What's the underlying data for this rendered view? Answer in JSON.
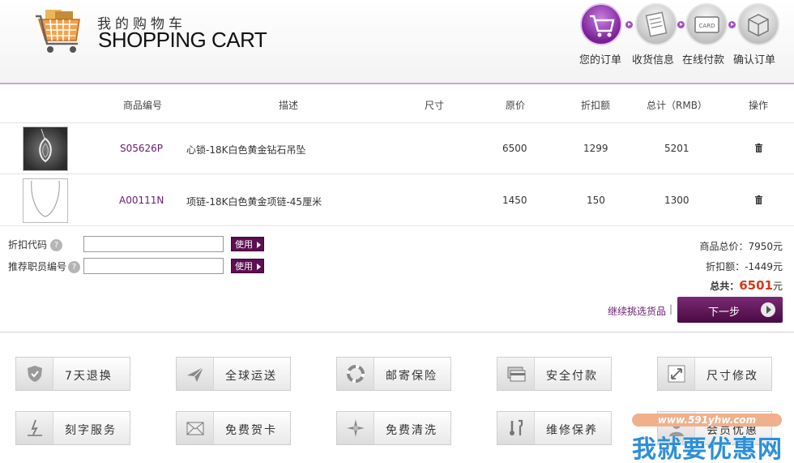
{
  "header": {
    "title_cn": "我的购物车",
    "title_en": "SHOPPING CART",
    "steps": [
      {
        "label": "您的订单",
        "active": true,
        "icon": "cart-icon"
      },
      {
        "label": "收货信息",
        "active": false,
        "icon": "document-icon"
      },
      {
        "label": "在线付款",
        "active": false,
        "icon": "card-icon",
        "icon_text": "CARD"
      },
      {
        "label": "确认订单",
        "active": false,
        "icon": "package-icon"
      }
    ]
  },
  "table": {
    "columns": [
      "商品编号",
      "描述",
      "尺寸",
      "原价",
      "折扣额",
      "总计（RMB）",
      "操作"
    ],
    "rows": [
      {
        "code": "S05626P",
        "desc": "心锁-18K白色黄金钻石吊坠",
        "size": "",
        "price": "6500",
        "discount": "1299",
        "total": "5201",
        "thumb": "pendant-image"
      },
      {
        "code": "A00111N",
        "desc": "项链-18K白色黄金项链-45厘米",
        "size": "",
        "price": "1450",
        "discount": "150",
        "total": "1300",
        "thumb": "necklace-image"
      }
    ]
  },
  "discount": {
    "code_label": "折扣代码",
    "staff_label": "推荐职员编号",
    "code_value": "",
    "staff_value": "",
    "use_label": "使用"
  },
  "summary": {
    "goods_total": "商品总价：7950元",
    "discount_total": "折扣额：-1449元",
    "total_label": "总共：",
    "total_value": "6501",
    "total_unit": "元"
  },
  "actions": {
    "continue_label": "继续挑选货品",
    "separator": "|",
    "next_label": "下一步"
  },
  "services": [
    {
      "label": "7天退换",
      "icon": "shield-icon"
    },
    {
      "label": "全球运送",
      "icon": "plane-icon"
    },
    {
      "label": "邮寄保险",
      "icon": "lifebuoy-icon"
    },
    {
      "label": "安全付款",
      "icon": "card-icon"
    },
    {
      "label": "尺寸修改",
      "icon": "resize-icon"
    },
    {
      "label": "刻字服务",
      "icon": "engrave-icon"
    },
    {
      "label": "免费贺卡",
      "icon": "envelope-icon"
    },
    {
      "label": "免费清洗",
      "icon": "sparkle-icon"
    },
    {
      "label": "维修保养",
      "icon": "tools-icon"
    },
    {
      "label": "会员优惠",
      "icon": "member-icon"
    }
  ],
  "watermark": {
    "url": "www.591yhw.com",
    "text": "我就要优惠网"
  },
  "colors": {
    "accent": "#5c0f52",
    "link": "#6a1b72",
    "total": "#d43a1a",
    "active_step": "#8e3aab"
  }
}
